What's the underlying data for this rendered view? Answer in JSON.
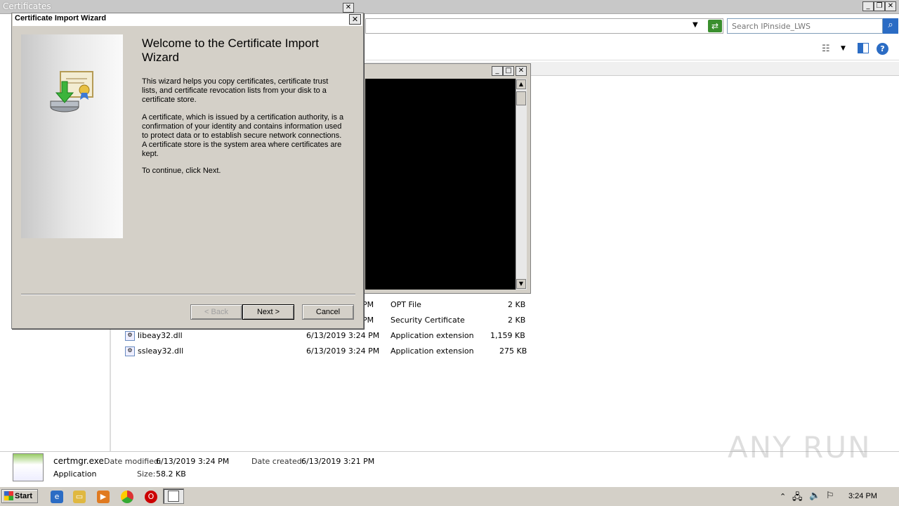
{
  "explorer": {
    "title": "Certificates",
    "search_placeholder": "Search IPinside_LWS",
    "files": [
      {
        "name": "",
        "date": "PM",
        "type": "OPT File",
        "size": "2 KB"
      },
      {
        "name": "",
        "date": "PM",
        "type": "Security Certificate",
        "size": "2 KB"
      },
      {
        "name": "libeay32.dll",
        "date": "6/13/2019 3:24 PM",
        "type": "Application extension",
        "size": "1,159 KB"
      },
      {
        "name": "ssleay32.dll",
        "date": "6/13/2019 3:24 PM",
        "type": "Application extension",
        "size": "275 KB"
      }
    ],
    "details": {
      "filename": "certmgr.exe",
      "modified_label": "Date modified:",
      "modified_value": "6/13/2019 3:24 PM",
      "created_label": "Date created:",
      "created_value": "6/13/2019 3:21 PM",
      "kind": "Application",
      "size_label": "Size:",
      "size_value": "58.2 KB"
    }
  },
  "wizard": {
    "title": "Certificate Import Wizard",
    "heading": "Welcome to the Certificate Import Wizard",
    "para1": "This wizard helps you copy certificates, certificate trust lists, and certificate revocation lists from your disk to a certificate store.",
    "para2": "A certificate, which is issued by a certification authority, is a confirmation of your identity and contains information used to protect data or to establish secure network connections. A certificate store is the system area where certificates are kept.",
    "para3": "To continue, click Next.",
    "back_label": "< Back",
    "next_label": "Next >",
    "cancel_label": "Cancel"
  },
  "taskbar": {
    "start_label": "Start",
    "clock": "3:24 PM"
  },
  "watermark": "ANY RUN"
}
